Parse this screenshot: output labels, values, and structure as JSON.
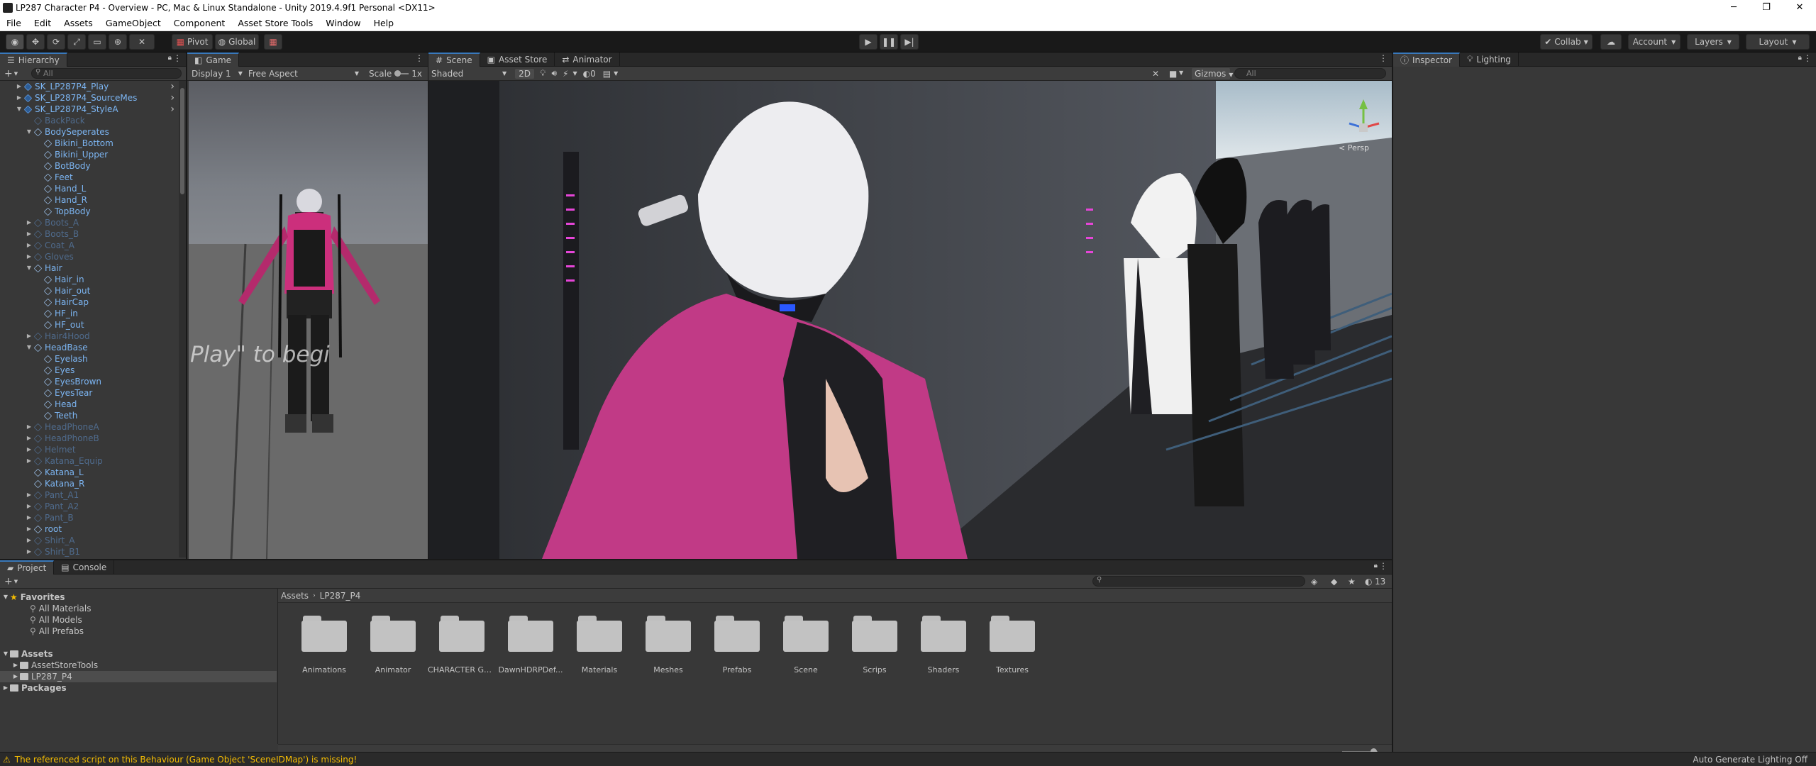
{
  "window": {
    "title": "LP287 Character P4 - Overview - PC, Mac & Linux Standalone - Unity 2019.4.9f1 Personal <DX11>",
    "minimize": "─",
    "restore": "❐",
    "close": "✕"
  },
  "menu": [
    "File",
    "Edit",
    "Assets",
    "GameObject",
    "Component",
    "Asset Store Tools",
    "Window",
    "Help"
  ],
  "toolbar": {
    "pivot": "Pivot",
    "global": "Global",
    "collab": "Collab",
    "account": "Account",
    "layers": "Layers",
    "layout": "Layout"
  },
  "hierarchy": {
    "title": "Hierarchy",
    "search_placeholder": "All",
    "add": "+",
    "rows": [
      {
        "label": "SK_LP287P4_Play",
        "indent": 1,
        "fold": "▶",
        "kind": "prefab",
        "arrow": true
      },
      {
        "label": "SK_LP287P4_SourceMes",
        "indent": 1,
        "fold": "▶",
        "kind": "prefab",
        "arrow": true
      },
      {
        "label": "SK_LP287P4_StyleA",
        "indent": 1,
        "fold": "▼",
        "kind": "prefab",
        "arrow": true
      },
      {
        "label": "BackPack",
        "indent": 2,
        "fold": "",
        "kind": "dim"
      },
      {
        "label": "BodySeperates",
        "indent": 2,
        "fold": "▼",
        "kind": "blue"
      },
      {
        "label": "Bikini_Bottom",
        "indent": 3,
        "fold": "",
        "kind": "blue"
      },
      {
        "label": "Bikini_Upper",
        "indent": 3,
        "fold": "",
        "kind": "blue"
      },
      {
        "label": "BotBody",
        "indent": 3,
        "fold": "",
        "kind": "blue"
      },
      {
        "label": "Feet",
        "indent": 3,
        "fold": "",
        "kind": "blue"
      },
      {
        "label": "Hand_L",
        "indent": 3,
        "fold": "",
        "kind": "blue"
      },
      {
        "label": "Hand_R",
        "indent": 3,
        "fold": "",
        "kind": "blue"
      },
      {
        "label": "TopBody",
        "indent": 3,
        "fold": "",
        "kind": "blue"
      },
      {
        "label": "Boots_A",
        "indent": 2,
        "fold": "▶",
        "kind": "dim"
      },
      {
        "label": "Boots_B",
        "indent": 2,
        "fold": "▶",
        "kind": "dim"
      },
      {
        "label": "Coat_A",
        "indent": 2,
        "fold": "▶",
        "kind": "dim"
      },
      {
        "label": "Gloves",
        "indent": 2,
        "fold": "▶",
        "kind": "dim"
      },
      {
        "label": "Hair",
        "indent": 2,
        "fold": "▼",
        "kind": "blue"
      },
      {
        "label": "Hair_in",
        "indent": 3,
        "fold": "",
        "kind": "blue"
      },
      {
        "label": "Hair_out",
        "indent": 3,
        "fold": "",
        "kind": "blue"
      },
      {
        "label": "HairCap",
        "indent": 3,
        "fold": "",
        "kind": "blue"
      },
      {
        "label": "HF_in",
        "indent": 3,
        "fold": "",
        "kind": "blue"
      },
      {
        "label": "HF_out",
        "indent": 3,
        "fold": "",
        "kind": "blue"
      },
      {
        "label": "Hair4Hood",
        "indent": 2,
        "fold": "▶",
        "kind": "dim"
      },
      {
        "label": "HeadBase",
        "indent": 2,
        "fold": "▼",
        "kind": "blue"
      },
      {
        "label": "Eyelash",
        "indent": 3,
        "fold": "",
        "kind": "blue"
      },
      {
        "label": "Eyes",
        "indent": 3,
        "fold": "",
        "kind": "blue"
      },
      {
        "label": "EyesBrown",
        "indent": 3,
        "fold": "",
        "kind": "blue"
      },
      {
        "label": "EyesTear",
        "indent": 3,
        "fold": "",
        "kind": "blue"
      },
      {
        "label": "Head",
        "indent": 3,
        "fold": "",
        "kind": "blue"
      },
      {
        "label": "Teeth",
        "indent": 3,
        "fold": "",
        "kind": "blue"
      },
      {
        "label": "HeadPhoneA",
        "indent": 2,
        "fold": "▶",
        "kind": "dim"
      },
      {
        "label": "HeadPhoneB",
        "indent": 2,
        "fold": "▶",
        "kind": "dim"
      },
      {
        "label": "Helmet",
        "indent": 2,
        "fold": "▶",
        "kind": "dim"
      },
      {
        "label": "Katana_Equip",
        "indent": 2,
        "fold": "▶",
        "kind": "dim"
      },
      {
        "label": "Katana_L",
        "indent": 2,
        "fold": "",
        "kind": "blue"
      },
      {
        "label": "Katana_R",
        "indent": 2,
        "fold": "",
        "kind": "blue"
      },
      {
        "label": "Pant_A1",
        "indent": 2,
        "fold": "▶",
        "kind": "dim"
      },
      {
        "label": "Pant_A2",
        "indent": 2,
        "fold": "▶",
        "kind": "dim"
      },
      {
        "label": "Pant_B",
        "indent": 2,
        "fold": "▶",
        "kind": "dim"
      },
      {
        "label": "root",
        "indent": 2,
        "fold": "▶",
        "kind": "blue"
      },
      {
        "label": "Shirt_A",
        "indent": 2,
        "fold": "▶",
        "kind": "dim"
      },
      {
        "label": "Shirt_B1",
        "indent": 2,
        "fold": "▶",
        "kind": "dim"
      }
    ]
  },
  "game": {
    "tab": "Game",
    "display": "Display 1",
    "aspect": "Free Aspect",
    "scale_label": "Scale",
    "scale_value": "1x",
    "overlay_text": "Play\" to begi"
  },
  "scene": {
    "tabs": [
      "Scene",
      "Asset Store",
      "Animator"
    ],
    "shading": "Shaded",
    "mode2d": "2D",
    "fx_count": "0",
    "gizmos": "Gizmos",
    "search_placeholder": "All",
    "persp_label": "< Persp"
  },
  "inspector": {
    "tabs": [
      "Inspector",
      "Lighting"
    ]
  },
  "project": {
    "tabs": [
      "Project",
      "Console"
    ],
    "count": "13",
    "breadcrumb": [
      "Assets",
      "LP287_P4"
    ],
    "tree": [
      {
        "label": "Favorites",
        "indent": 0,
        "fold": "▼",
        "kind": "star",
        "bold": true
      },
      {
        "label": "All Materials",
        "indent": 2,
        "fold": "",
        "kind": "search"
      },
      {
        "label": "All Models",
        "indent": 2,
        "fold": "",
        "kind": "search"
      },
      {
        "label": "All Prefabs",
        "indent": 2,
        "fold": "",
        "kind": "search"
      },
      {
        "label": "",
        "indent": 0,
        "fold": "",
        "kind": "spacer"
      },
      {
        "label": "Assets",
        "indent": 0,
        "fold": "▼",
        "kind": "folder",
        "bold": true
      },
      {
        "label": "AssetStoreTools",
        "indent": 1,
        "fold": "▶",
        "kind": "folder"
      },
      {
        "label": "LP287_P4",
        "indent": 1,
        "fold": "▶",
        "kind": "folder",
        "selected": true
      },
      {
        "label": "Packages",
        "indent": 0,
        "fold": "▶",
        "kind": "folder",
        "bold": true
      }
    ],
    "folders": [
      "Animations",
      "Animator",
      "CHARACTER GU...",
      "DawnHDRPDef...",
      "Materials",
      "Meshes",
      "Prefabs",
      "Scene",
      "Scrips",
      "Shaders",
      "Textures"
    ]
  },
  "status": {
    "warning": "The referenced script on this Behaviour (Game Object 'SceneIDMap') is missing!",
    "right": "Auto Generate Lighting Off"
  },
  "colors": {
    "accent": "#3a79bb",
    "warning": "#f4bc02",
    "hierarchy_text": "#7cb5f2"
  }
}
